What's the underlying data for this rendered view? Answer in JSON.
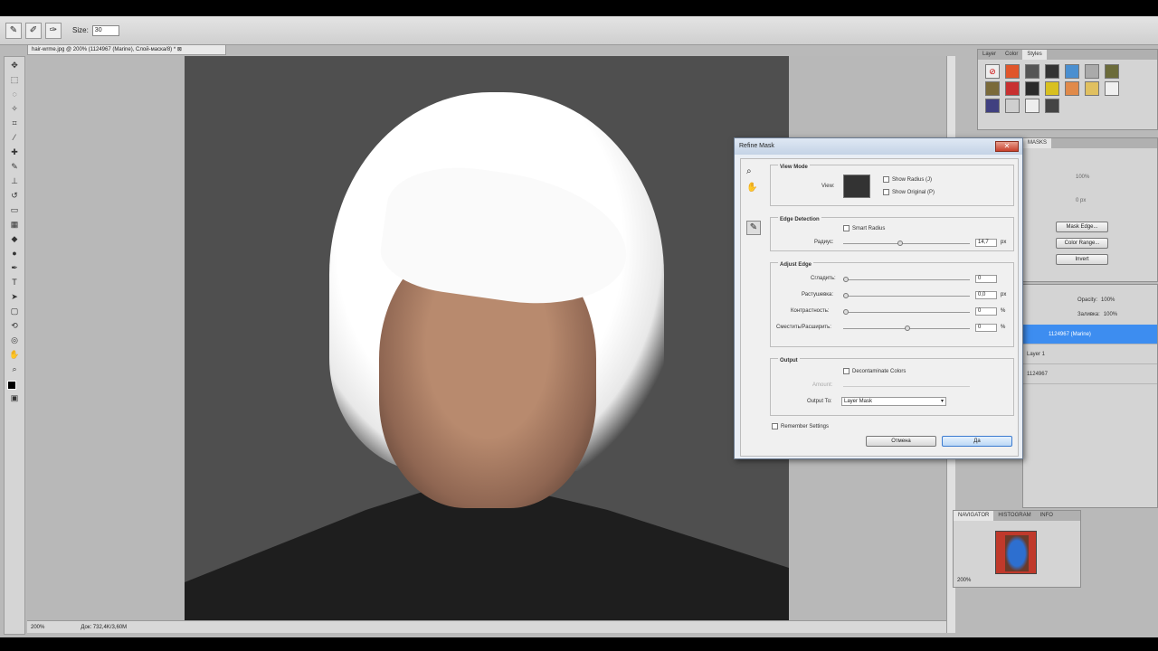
{
  "options_bar": {
    "size_label": "Size:",
    "size_value": "30"
  },
  "document": {
    "tab_title": "hair-wrme.jpg @ 200% (1124967 (Marine), Слой-маска/8) * ⊠",
    "zoom": "200%",
    "doc_info": "Док: 732,4K/3,60M"
  },
  "styles_panel": {
    "tabs": [
      "Layer",
      "Color",
      "Styles"
    ],
    "active_tab": "Styles"
  },
  "masks_panel": {
    "tab": "MASKS",
    "density": "100%",
    "feather": "0 px",
    "mask_edge": "Mask Edge...",
    "color_range": "Color Range...",
    "invert": "Invert"
  },
  "layers_panel": {
    "opacity_label": "Opacity:",
    "opacity_value": "100%",
    "fill_label": "Заливка:",
    "fill_value": "100%",
    "layers": [
      {
        "name": "1124967 (Marine)",
        "selected": true
      },
      {
        "name": "Layer 1",
        "selected": false
      },
      {
        "name": "1124967",
        "selected": false
      }
    ]
  },
  "navigator_panel": {
    "tabs": [
      "NAVIGATOR",
      "HISTOGRAM",
      "INFO"
    ],
    "zoom": "200%"
  },
  "refine_mask": {
    "title": "Refine Mask",
    "view_mode": {
      "title": "View Mode",
      "view_label": "View:",
      "show_radius": "Show Radius (J)",
      "show_original": "Show Original (P)"
    },
    "edge_detection": {
      "title": "Edge Detection",
      "smart_radius": "Smart Radius",
      "radius_label": "Радиус:",
      "radius_value": "14,7",
      "radius_unit": "px"
    },
    "adjust_edge": {
      "title": "Adjust Edge",
      "smooth_label": "Сгладить:",
      "smooth_value": "0",
      "feather_label": "Растушевка:",
      "feather_value": "0,0",
      "feather_unit": "px",
      "contrast_label": "Контрастность:",
      "contrast_value": "0",
      "contrast_unit": "%",
      "shift_label": "Сместить/Расширить:",
      "shift_value": "0",
      "shift_unit": "%"
    },
    "output": {
      "title": "Output",
      "decontaminate": "Decontaminate Colors",
      "amount_label": "Amount:",
      "output_to_label": "Output To:",
      "output_to_value": "Layer Mask"
    },
    "remember": "Remember Settings",
    "cancel": "Отмена",
    "ok": "Да"
  }
}
